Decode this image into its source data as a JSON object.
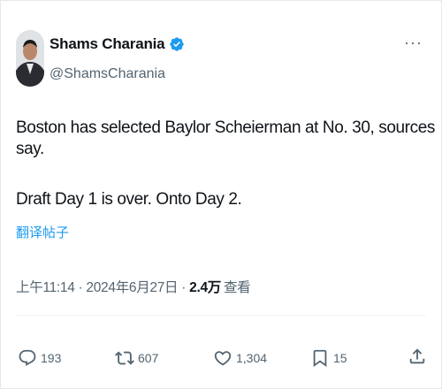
{
  "author": {
    "name": "Shams Charania",
    "handle": "@ShamsCharania"
  },
  "tweet": {
    "line1": "Boston has selected Baylor Scheierman at No. 30, sources say.",
    "line2": "Draft Day 1 is over. Onto Day 2."
  },
  "translate_label": "翻译帖子",
  "meta": {
    "time_date": "上午11:14 · 2024年6月27日 ·",
    "views_count": "2.4万",
    "views_label": "查看"
  },
  "actions": {
    "replies": "193",
    "reposts": "607",
    "likes": "1,304",
    "bookmarks": "15"
  },
  "colors": {
    "accent": "#1d9bf0",
    "secondary_text": "#536471",
    "primary_text": "#0f1419"
  },
  "icons": [
    "verified-badge-icon",
    "more-icon",
    "reply-icon",
    "repost-icon",
    "like-icon",
    "bookmark-icon",
    "share-icon"
  ]
}
